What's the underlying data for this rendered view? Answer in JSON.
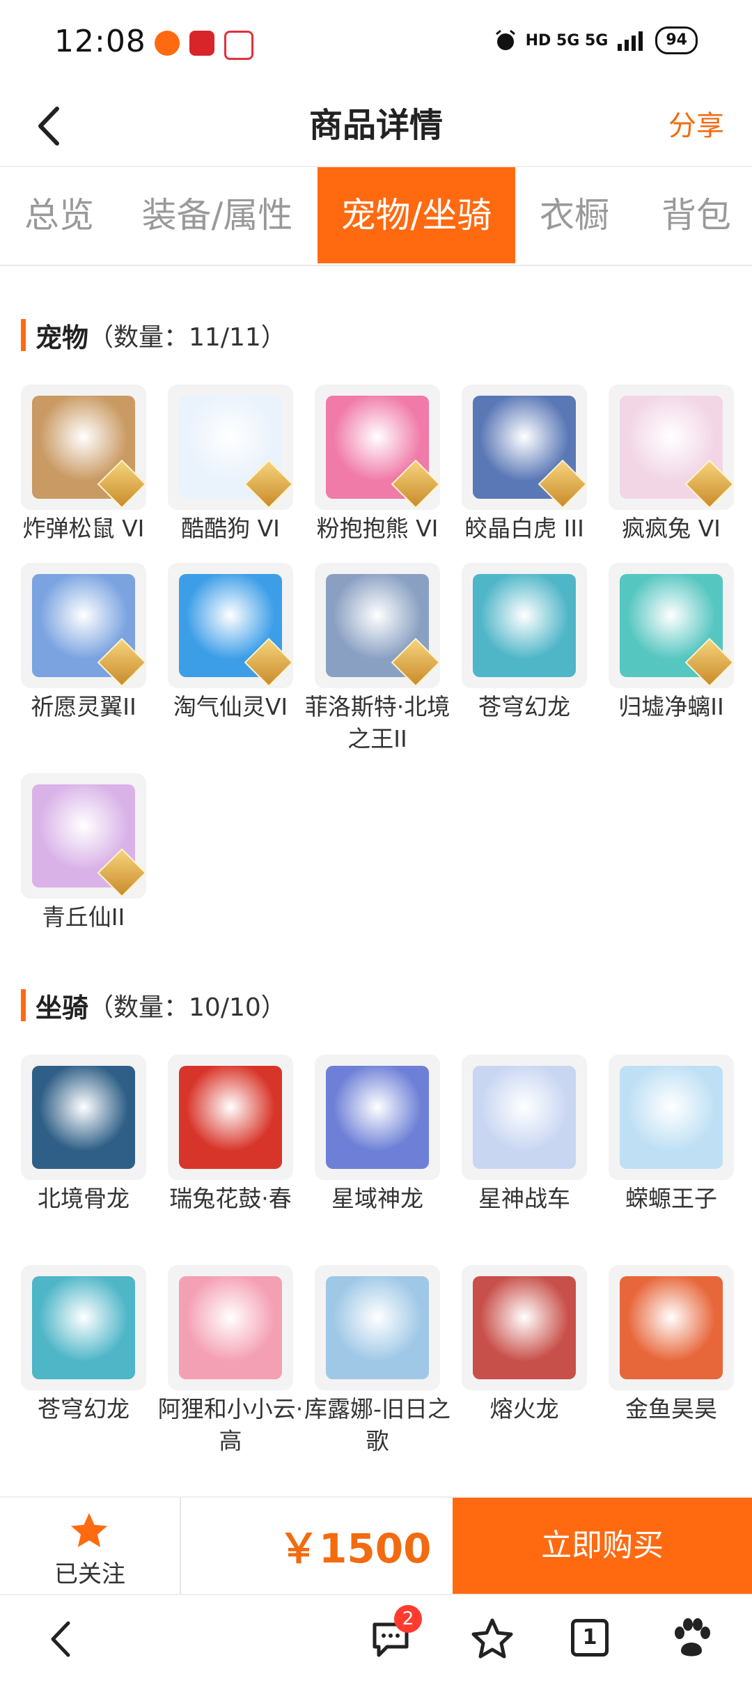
{
  "status_bar": {
    "time": "12:08",
    "battery": "94",
    "network": "HD 5G 5G"
  },
  "header": {
    "title": "商品详情",
    "share_label": "分享"
  },
  "tabs": [
    {
      "label": "总览"
    },
    {
      "label": "装备/属性"
    },
    {
      "label": "宠物/坐骑",
      "active": true
    },
    {
      "label": "衣橱"
    },
    {
      "label": "背包"
    }
  ],
  "pets_section": {
    "title": "宠物",
    "count_text": "（数量：11/11）",
    "items": [
      {
        "name": "炸弹松鼠 VI",
        "badge": "VI",
        "color": "#c99a63"
      },
      {
        "name": "酷酷狗 VI",
        "badge": "VI",
        "color": "#eaf2fb"
      },
      {
        "name": "粉抱抱熊 VI",
        "badge": "VI",
        "color": "#f07aa8"
      },
      {
        "name": "皎晶白虎 III",
        "badge": "III",
        "color": "#5b78b6"
      },
      {
        "name": "疯疯兔 VI",
        "badge": "VI",
        "color": "#f2d6e6"
      },
      {
        "name": "祈愿灵翼II",
        "badge": "II",
        "color": "#7aa3e0"
      },
      {
        "name": "淘气仙灵VI",
        "badge": "VI",
        "color": "#3d9ee8"
      },
      {
        "name": "菲洛斯特·北境之王II",
        "badge": "II",
        "color": "#8aa0c2"
      },
      {
        "name": "苍穹幻龙",
        "badge": "",
        "color": "#4fb6c8"
      },
      {
        "name": "归墟净螭II",
        "badge": "II",
        "color": "#56c6c0"
      },
      {
        "name": "青丘仙II",
        "badge": "II",
        "color": "#d9b3e8"
      }
    ]
  },
  "mounts_section": {
    "title": "坐骑",
    "count_text": "（数量：10/10）",
    "items": [
      {
        "name": "北境骨龙",
        "color": "#2f5f86"
      },
      {
        "name": "瑞兔花鼓·春",
        "color": "#d8352a"
      },
      {
        "name": "星域神龙",
        "color": "#6d7fd6"
      },
      {
        "name": "星神战车",
        "color": "#c9d6f2"
      },
      {
        "name": "蝾螈王子",
        "color": "#bfe0f4"
      },
      {
        "name": "苍穹幻龙",
        "color": "#4fb6c8"
      },
      {
        "name": "阿狸和小小云·高",
        "color": "#f4a0b4"
      },
      {
        "name": "库露娜-旧日之歌",
        "color": "#9fc8e6"
      },
      {
        "name": "熔火龙",
        "color": "#c8504a"
      },
      {
        "name": "金鱼昊昊",
        "color": "#e7663a"
      }
    ]
  },
  "bottom_bar": {
    "follow_label": "已关注",
    "price": "￥1500",
    "buy_label": "立即购买"
  },
  "browser_nav": {
    "message_count": "2",
    "tab_count": "1"
  },
  "colors": {
    "accent": "#ff6a10"
  }
}
